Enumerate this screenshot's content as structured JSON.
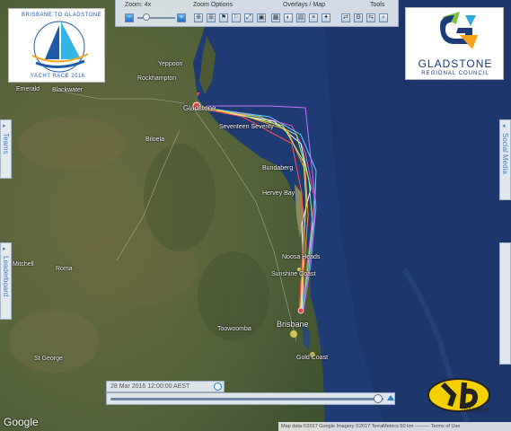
{
  "toolbar": {
    "zoom_label": "Zoom: 4x",
    "zoom_options_label": "Zoom Options",
    "overlays_label": "Overlays / Map",
    "tools_label": "Tools",
    "zoom_level": 4
  },
  "logos": {
    "race_top": "BRISBANE TO GLADSTONE",
    "race_bottom": "YACHT RACE 2016",
    "council_title": "GLADSTONE",
    "council_sub": "REGIONAL COUNCIL"
  },
  "side_tabs": {
    "teams": "Teams",
    "leaderboard": "Leaderboard",
    "social": "Social Media"
  },
  "places": {
    "yeppoon": "Yeppoon",
    "rockhampton": "Rockhampton",
    "emerald": "Emerald",
    "blackwater": "Blackwater",
    "gladstone": "Gladstone",
    "biloela": "Biloela",
    "seventeen": "Seventeen Seventy",
    "bundaberg": "Bundaberg",
    "hervey_bay": "Hervey Bay",
    "noosa": "Noosa Heads",
    "sunshine": "Sunshine Coast",
    "mitchell": "Mitchell",
    "roma": "Roma",
    "toowoomba": "Toowoomba",
    "brisbane": "Brisbane",
    "st_george": "St George",
    "gold_coast": "Gold Coast"
  },
  "timeline": {
    "datetime": "28 Mar 2016 12:00:00 AEST",
    "progress": 0.98
  },
  "tracking_label": "TRACKING",
  "google_label": "Google",
  "attribution": "Map data ©2017 Google Imagery ©2017 TerraMetrics   50 km ———   Terms of Use",
  "colors": {
    "ocean": "#1f3f78",
    "land": "#5b6a3a",
    "track_palette": [
      "#ff4fb0",
      "#ffffff",
      "#8ef07a",
      "#ff9a3a",
      "#5fd0ff",
      "#e9f060",
      "#c070ff",
      "#ff5050"
    ]
  }
}
